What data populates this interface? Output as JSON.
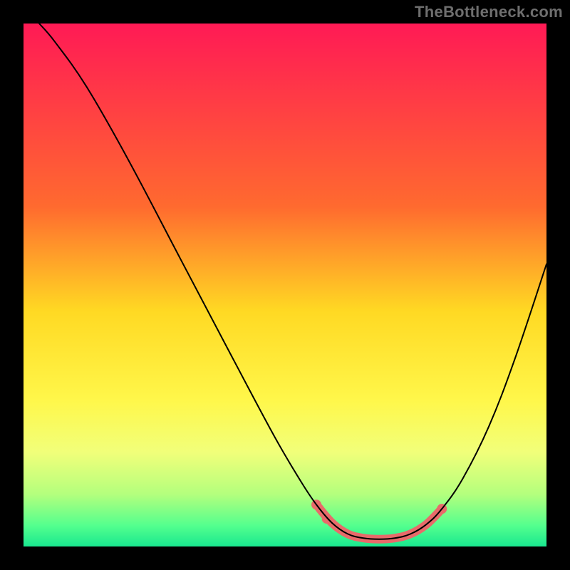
{
  "watermark": "TheBottleneck.com",
  "chart_data": {
    "type": "line",
    "title": "",
    "xlabel": "",
    "ylabel": "",
    "xlim": [
      0,
      100
    ],
    "ylim": [
      0,
      100
    ],
    "gradient_stops": [
      {
        "offset": 0,
        "color": "#ff1a55"
      },
      {
        "offset": 35,
        "color": "#ff6a2f"
      },
      {
        "offset": 55,
        "color": "#ffd923"
      },
      {
        "offset": 72,
        "color": "#fff74a"
      },
      {
        "offset": 82,
        "color": "#f1ff7a"
      },
      {
        "offset": 90,
        "color": "#b4ff7d"
      },
      {
        "offset": 96,
        "color": "#54ff8e"
      },
      {
        "offset": 100,
        "color": "#19e88f"
      }
    ],
    "series": [
      {
        "name": "bottleneck-curve",
        "color": "#000000",
        "width": 2,
        "points": [
          {
            "x": 3.0,
            "y": 100.0
          },
          {
            "x": 6.0,
            "y": 96.5
          },
          {
            "x": 12.0,
            "y": 88.0
          },
          {
            "x": 20.0,
            "y": 74.0
          },
          {
            "x": 30.0,
            "y": 55.0
          },
          {
            "x": 40.0,
            "y": 36.0
          },
          {
            "x": 48.0,
            "y": 21.0
          },
          {
            "x": 53.0,
            "y": 12.5
          },
          {
            "x": 56.0,
            "y": 8.0
          },
          {
            "x": 59.0,
            "y": 4.5
          },
          {
            "x": 62.0,
            "y": 2.4
          },
          {
            "x": 65.0,
            "y": 1.6
          },
          {
            "x": 68.0,
            "y": 1.4
          },
          {
            "x": 71.0,
            "y": 1.6
          },
          {
            "x": 74.0,
            "y": 2.4
          },
          {
            "x": 77.0,
            "y": 4.2
          },
          {
            "x": 80.0,
            "y": 7.2
          },
          {
            "x": 84.0,
            "y": 13.0
          },
          {
            "x": 89.0,
            "y": 23.0
          },
          {
            "x": 94.0,
            "y": 36.0
          },
          {
            "x": 100.0,
            "y": 54.0
          }
        ]
      },
      {
        "name": "highlight-segment",
        "color": "#e86a6a",
        "width": 12,
        "points": [
          {
            "x": 56.0,
            "y": 8.0
          },
          {
            "x": 59.0,
            "y": 4.5
          },
          {
            "x": 62.0,
            "y": 2.4
          },
          {
            "x": 65.0,
            "y": 1.6
          },
          {
            "x": 68.0,
            "y": 1.4
          },
          {
            "x": 71.0,
            "y": 1.6
          },
          {
            "x": 74.0,
            "y": 2.4
          },
          {
            "x": 77.0,
            "y": 4.2
          },
          {
            "x": 80.0,
            "y": 7.2
          }
        ]
      }
    ],
    "markers": {
      "color": "#e86a6a",
      "radius": 7,
      "points": [
        {
          "x": 56.0,
          "y": 8.0
        },
        {
          "x": 58.0,
          "y": 5.3
        },
        {
          "x": 80.0,
          "y": 7.2
        }
      ]
    }
  }
}
